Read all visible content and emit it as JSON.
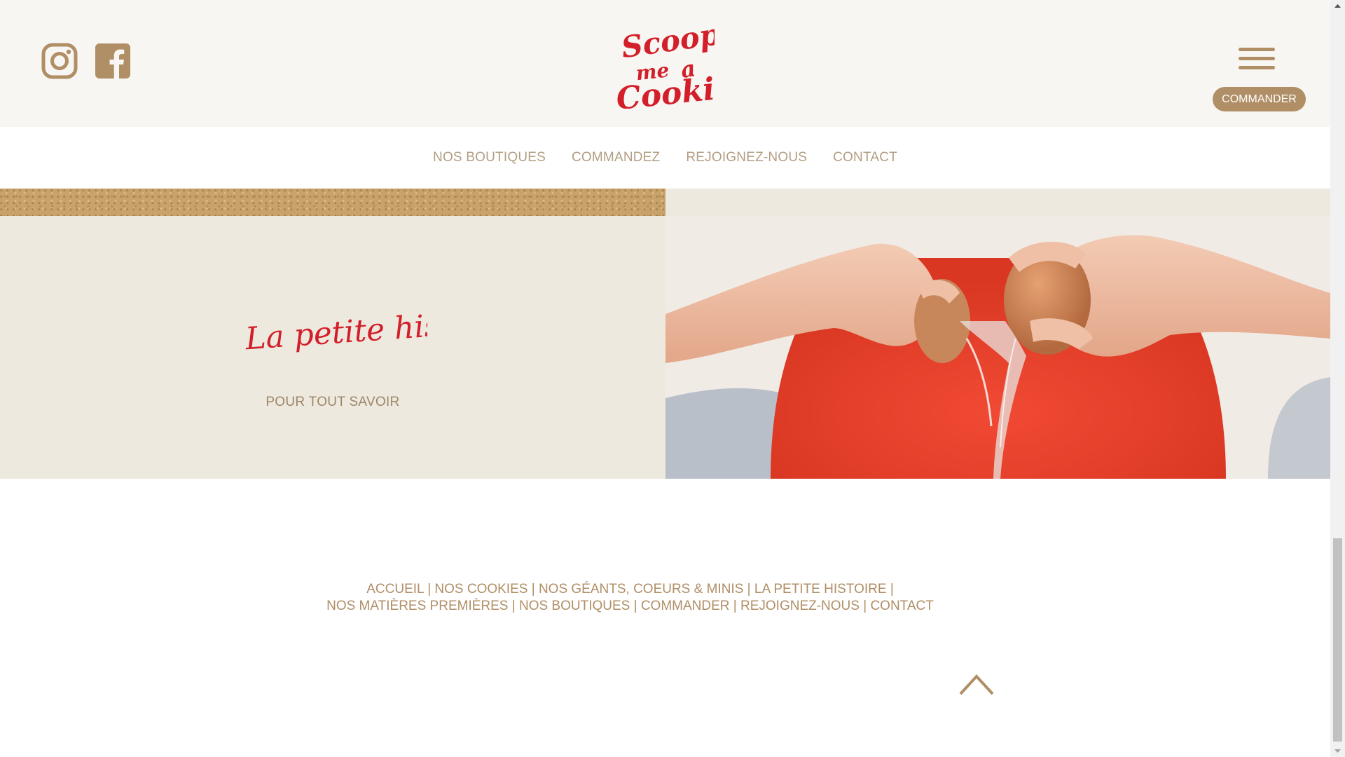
{
  "header": {
    "social": [
      {
        "name": "Instagram",
        "icon": "instagram-icon"
      },
      {
        "name": "Facebook",
        "icon": "facebook-icon"
      }
    ],
    "logo": {
      "line1": "Scoop",
      "line2": "me",
      "line3": "a",
      "line4": "Cookie",
      "color": "#d31f2a"
    },
    "menu_icon": "hamburger-icon",
    "order_button": "COMMANDER"
  },
  "nav": {
    "items": [
      "NOS BOUTIQUES",
      "COMMANDEZ",
      "REJOIGNEZ-NOUS",
      "CONTACT"
    ]
  },
  "story": {
    "title": "La petite histoire",
    "link": "POUR TOUT SAVOIR"
  },
  "footer": {
    "row1": [
      "ACCUEIL",
      "NOS COOKIES",
      "NOS GÉANTS, COEURS & MINIS",
      "LA PETITE HISTOIRE"
    ],
    "row2": [
      "NOS MATIÈRES PREMIÈRES",
      "NOS BOUTIQUES",
      "COMMANDER",
      "REJOIGNEZ-NOUS",
      "CONTACT"
    ],
    "separator": "|",
    "back_to_top_icon": "chevron-up-icon"
  },
  "colors": {
    "accent": "#b08e66",
    "brand_red": "#d31f2a",
    "header_bg": "#f8f6f2",
    "panel_bg": "#eee9df"
  }
}
